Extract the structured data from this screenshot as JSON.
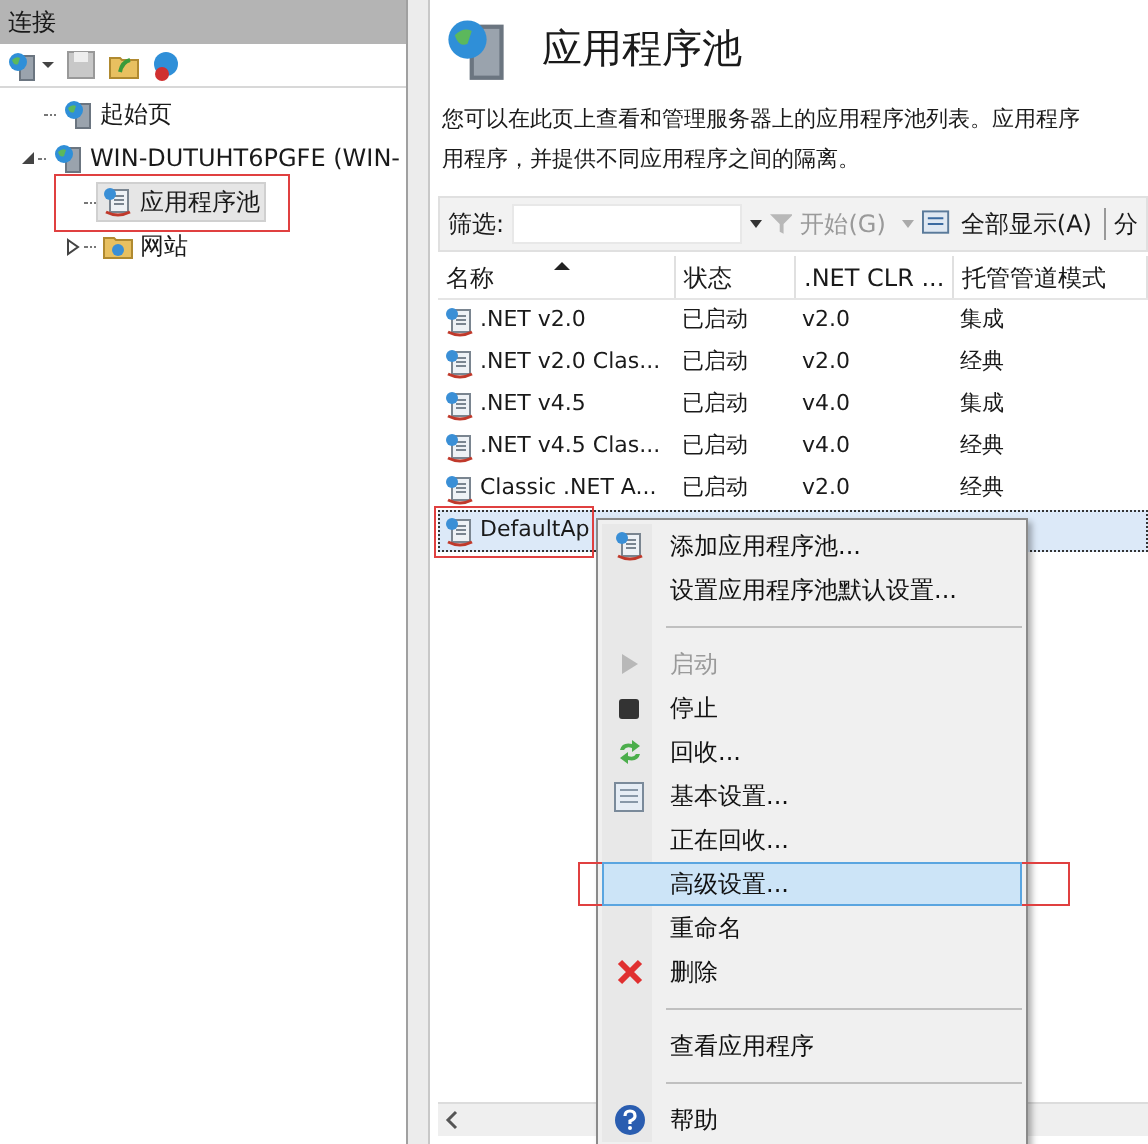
{
  "connections": {
    "title": "连接",
    "tree": [
      {
        "label": "起始页",
        "selected": false,
        "annotated": false
      },
      {
        "label": "WIN-DUTUHT6PGFE (WIN-",
        "expanded": true,
        "selected": false,
        "annotated": false,
        "children": [
          {
            "label": "应用程序池",
            "selected": true,
            "annotated": true
          },
          {
            "label": "网站",
            "expanded": false,
            "selected": false,
            "annotated": false
          }
        ]
      }
    ]
  },
  "page": {
    "title": "应用程序池",
    "description": [
      "您可以在此页上查看和管理服务器上的应用程序池列表。应用程序",
      "用程序，并提供不同应用程序之间的隔离。"
    ],
    "filter_label": "筛选:",
    "start_button": "开始(G)",
    "show_all_button": "全部显示(A)",
    "group_button": "分"
  },
  "table": {
    "columns": [
      "名称",
      "状态",
      ".NET CLR ...",
      "托管管道模式"
    ],
    "rows": [
      {
        "cells": [
          ".NET v2.0",
          "已启动",
          "v2.0",
          "集成"
        ],
        "selected": false,
        "annotated": false
      },
      {
        "cells": [
          ".NET v2.0 Clas...",
          "已启动",
          "v2.0",
          "经典"
        ],
        "selected": false,
        "annotated": false
      },
      {
        "cells": [
          ".NET v4.5",
          "已启动",
          "v4.0",
          "集成"
        ],
        "selected": false,
        "annotated": false
      },
      {
        "cells": [
          ".NET v4.5 Clas...",
          "已启动",
          "v4.0",
          "经典"
        ],
        "selected": false,
        "annotated": false
      },
      {
        "cells": [
          "Classic .NET A...",
          "已启动",
          "v2.0",
          "经典"
        ],
        "selected": false,
        "annotated": false
      },
      {
        "cells": [
          "DefaultAp"
        ],
        "selected": true,
        "annotated": true
      }
    ]
  },
  "context_menu": [
    {
      "kind": "item",
      "label": "添加应用程序池...",
      "disabled": false,
      "selected": false,
      "annotated": false
    },
    {
      "kind": "item",
      "label": "设置应用程序池默认设置...",
      "disabled": false,
      "selected": false,
      "annotated": false
    },
    {
      "kind": "separator"
    },
    {
      "kind": "item",
      "label": "启动",
      "disabled": true,
      "selected": false,
      "annotated": false
    },
    {
      "kind": "item",
      "label": "停止",
      "disabled": false,
      "selected": false,
      "annotated": false
    },
    {
      "kind": "item",
      "label": "回收...",
      "disabled": false,
      "selected": false,
      "annotated": false
    },
    {
      "kind": "item",
      "label": "基本设置...",
      "disabled": false,
      "selected": false,
      "annotated": false
    },
    {
      "kind": "item",
      "label": "正在回收...",
      "disabled": false,
      "selected": false,
      "annotated": false
    },
    {
      "kind": "item",
      "label": "高级设置...",
      "disabled": false,
      "selected": true,
      "annotated": true
    },
    {
      "kind": "item",
      "label": "重命名",
      "disabled": false,
      "selected": false,
      "annotated": false
    },
    {
      "kind": "item",
      "label": "删除",
      "disabled": false,
      "selected": false,
      "annotated": false
    },
    {
      "kind": "separator"
    },
    {
      "kind": "item",
      "label": "查看应用程序",
      "disabled": false,
      "selected": false,
      "annotated": false
    },
    {
      "kind": "separator"
    },
    {
      "kind": "item",
      "label": "帮助",
      "disabled": false,
      "selected": false,
      "annotated": false
    }
  ]
}
